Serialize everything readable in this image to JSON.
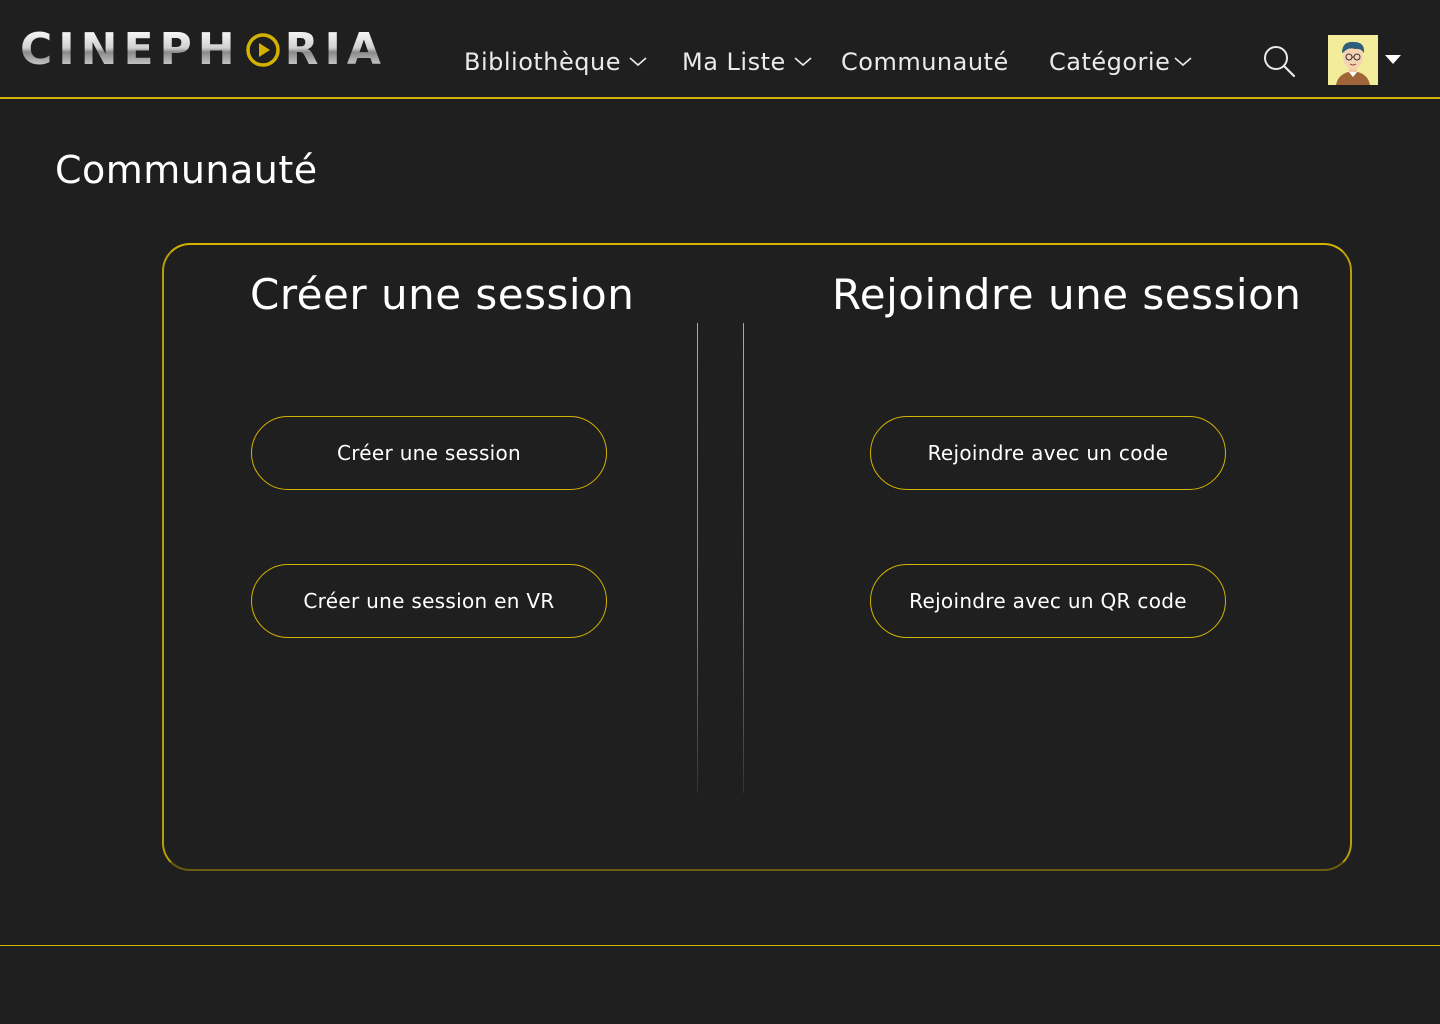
{
  "brand": {
    "logo_left": "CINEPH",
    "logo_right": "RIA"
  },
  "nav": {
    "items": [
      {
        "label": "Bibliothèque",
        "has_dropdown": true
      },
      {
        "label": "Ma Liste",
        "has_dropdown": true
      },
      {
        "label": "Communauté",
        "has_dropdown": false
      },
      {
        "label": "Catégorie",
        "has_dropdown": true
      }
    ]
  },
  "header_icons": {
    "search": "search-icon",
    "avatar": "user-avatar",
    "caret": "caret-down-icon"
  },
  "page": {
    "title": "Communauté"
  },
  "create": {
    "heading": "Créer une session",
    "button_create": "Créer une session",
    "button_create_vr": "Créer une session en VR"
  },
  "join": {
    "heading": "Rejoindre une session",
    "button_code": "Rejoindre avec un code",
    "button_qr": "Rejoindre avec un QR code"
  },
  "colors": {
    "background": "#1f1f1f",
    "accent": "#d4b300",
    "text": "#ffffff"
  }
}
